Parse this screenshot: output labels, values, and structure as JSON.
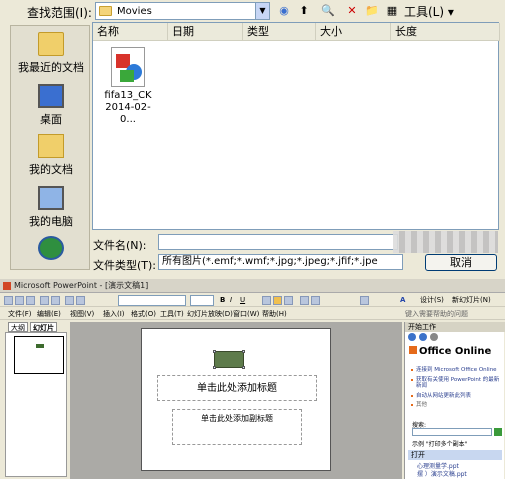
{
  "dialog": {
    "look_in_label": "查找范围(I):",
    "look_in_value": "Movies",
    "tools_label": "工具(L)",
    "places": [
      {
        "label": "我最近的文档",
        "icon": "folder-icon"
      },
      {
        "label": "桌面",
        "icon": "desktop-icon"
      },
      {
        "label": "我的文档",
        "icon": "documents-icon"
      },
      {
        "label": "我的电脑",
        "icon": "computer-icon"
      },
      {
        "label": "",
        "icon": "network-icon"
      }
    ],
    "columns": [
      "名称",
      "日期",
      "类型",
      "大小",
      "长度"
    ],
    "file": {
      "name_line1": "fifa13_CK",
      "name_line2": "2014-02-0..."
    },
    "file_name_label": "文件名(N):",
    "file_name_value": "",
    "file_type_label": "文件类型(T):",
    "file_type_value": "所有图片(*.emf;*.wmf;*.jpg;*.jpeg;*.jfif;*.jpe",
    "cancel_label": "取消"
  },
  "ppt": {
    "title": "Microsoft PowerPoint - [演示文稿1]",
    "menu": [
      "文件(F)",
      "编辑(E)",
      "视图(V)",
      "插入(I)",
      "格式(O)",
      "工具(T)",
      "幻灯片放映(D)",
      "窗口(W)",
      "帮助(H)"
    ],
    "toolbar_right": [
      "设计(S)",
      "新幻灯片(N)"
    ],
    "help_placeholder": "键入需要帮助的问题",
    "pane_tabs": [
      "大纲",
      "幻灯片"
    ],
    "slide_title_placeholder": "单击此处添加标题",
    "slide_subtitle_placeholder": "单击此处添加副标题",
    "task_pane": {
      "header": "开始工作",
      "logo_text": "Office Online",
      "bullets": [
        "连接到 Microsoft Office Online",
        "获取有关使用 PowerPoint 的最新新闻",
        "自动从网站更新此列表"
      ],
      "more": "其他",
      "search_label": "搜索:",
      "example": "示例 \"打印多个副本\"",
      "open_header": "打开",
      "recent_files": [
        "心理测量学.ppt",
        "摆 ）演示文稿.ppt"
      ]
    }
  }
}
